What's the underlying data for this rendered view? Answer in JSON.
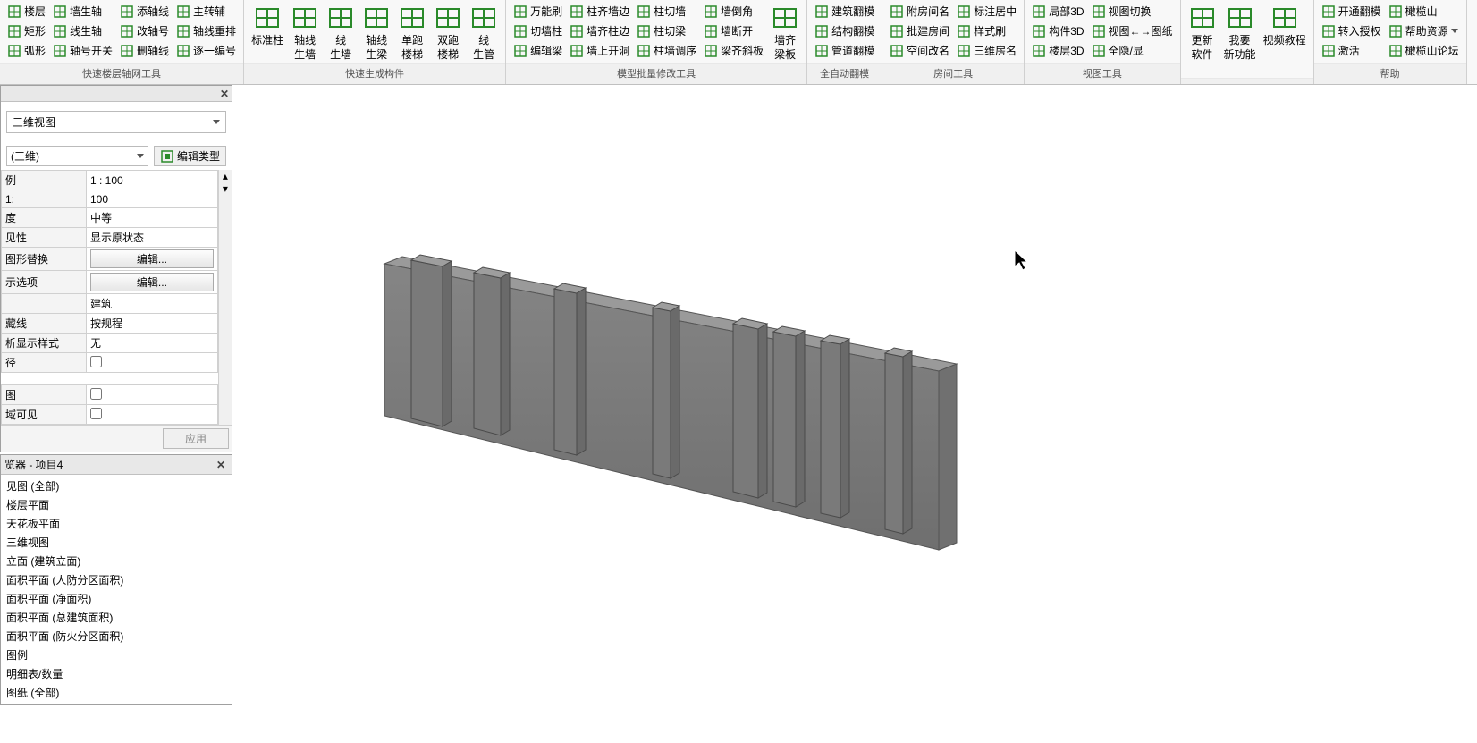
{
  "ribbon": {
    "groups": [
      {
        "title": "快速楼层轴网工具",
        "columns": [
          {
            "items": [
              {
                "icon": "floor-icon",
                "label": "楼层"
              },
              {
                "icon": "rect-icon",
                "label": "矩形"
              },
              {
                "icon": "arc-icon",
                "label": "弧形"
              }
            ]
          },
          {
            "items": [
              {
                "icon": "wall-axis-icon",
                "label": "墙生轴"
              },
              {
                "icon": "line-axis-icon",
                "label": "线生轴"
              },
              {
                "icon": "axis-switch-icon",
                "label": "轴号开关"
              }
            ]
          },
          {
            "items": [
              {
                "icon": "add-axis-icon",
                "label": "添轴线"
              },
              {
                "icon": "renumber-icon",
                "label": "改轴号"
              },
              {
                "icon": "del-axis-icon",
                "label": "删轴线"
              }
            ]
          },
          {
            "items": [
              {
                "icon": "main-aux-icon",
                "label": "主转辅"
              },
              {
                "icon": "reorder-axis-icon",
                "label": "轴线重排"
              },
              {
                "icon": "seq-number-icon",
                "label": "逐一编号"
              }
            ]
          }
        ]
      },
      {
        "title": "快速生成构件",
        "large": [
          {
            "icon": "std-col-icon",
            "label": "标准柱"
          },
          {
            "icon": "axis-wall-icon",
            "label": "轴线\n生墙"
          },
          {
            "icon": "line-wall-icon",
            "label": "线\n生墙"
          },
          {
            "icon": "axis-beam-icon",
            "label": "轴线\n生梁"
          },
          {
            "icon": "single-stair-icon",
            "label": "单跑\n楼梯"
          },
          {
            "icon": "double-stair-icon",
            "label": "双跑\n楼梯"
          },
          {
            "icon": "line-pipe-icon",
            "label": "线\n生管"
          }
        ]
      },
      {
        "title": "模型批量修改工具",
        "columns": [
          {
            "items": [
              {
                "icon": "brush-icon",
                "label": "万能刷"
              },
              {
                "icon": "cut-col-icon",
                "label": "切墙柱"
              },
              {
                "icon": "edit-beam-icon",
                "label": "编辑梁"
              }
            ]
          },
          {
            "items": [
              {
                "icon": "col-edge-icon",
                "label": "柱齐墙边"
              },
              {
                "icon": "wall-edge-icon",
                "label": "墙齐柱边"
              },
              {
                "icon": "wall-open-icon",
                "label": "墙上开洞"
              }
            ]
          },
          {
            "items": [
              {
                "icon": "col-cut-icon",
                "label": "柱切墙"
              },
              {
                "icon": "col-beam-icon",
                "label": "柱切梁"
              },
              {
                "icon": "col-adj-icon",
                "label": "柱墙调序"
              }
            ]
          },
          {
            "items": [
              {
                "icon": "wall-chamfer-icon",
                "label": "墙倒角"
              },
              {
                "icon": "wall-break-icon",
                "label": "墙断开"
              },
              {
                "icon": "beam-slant-icon",
                "label": "梁齐斜板"
              }
            ]
          }
        ],
        "large": [
          {
            "icon": "wall-align-icon",
            "label": "墙齐\n梁板"
          }
        ]
      },
      {
        "title": "全自动翻模",
        "columns": [
          {
            "items": [
              {
                "icon": "arch-flip-icon",
                "label": "建筑翻模"
              },
              {
                "icon": "struct-flip-icon",
                "label": "结构翻模"
              },
              {
                "icon": "pipe-flip-icon",
                "label": "管道翻模"
              }
            ]
          }
        ]
      },
      {
        "title": "房间工具",
        "columns": [
          {
            "items": [
              {
                "icon": "attach-room-icon",
                "label": "附房间名"
              },
              {
                "icon": "batch-room-icon",
                "label": "批建房间"
              },
              {
                "icon": "rename-space-icon",
                "label": "空间改名"
              }
            ]
          },
          {
            "items": [
              {
                "icon": "center-label-icon",
                "label": "标注居中"
              },
              {
                "icon": "style-brush-icon",
                "label": "样式刷"
              },
              {
                "icon": "room-3d-icon",
                "label": "三维房名"
              }
            ]
          }
        ]
      },
      {
        "title": "视图工具",
        "columns": [
          {
            "items": [
              {
                "icon": "local3d-icon",
                "label": "局部3D"
              },
              {
                "icon": "comp3d-icon",
                "label": "构件3D"
              },
              {
                "icon": "floor3d-icon",
                "label": "楼层3D"
              }
            ]
          },
          {
            "items": [
              {
                "icon": "view-switch-icon",
                "label": "视图切换"
              },
              {
                "icon": "view-to-sheet-icon",
                "label": "视图←→图纸"
              },
              {
                "icon": "full-hide-icon",
                "label": "全隐/显"
              }
            ]
          }
        ]
      },
      {
        "title": "",
        "large": [
          {
            "icon": "update-sw-icon",
            "label": "更新\n软件"
          },
          {
            "icon": "new-feat-icon",
            "label": "我要\n新功能"
          },
          {
            "icon": "video-icon",
            "label": "视频教程"
          }
        ]
      },
      {
        "title": "帮助",
        "columns": [
          {
            "items": [
              {
                "icon": "unlock-icon",
                "label": "开通翻模"
              },
              {
                "icon": "auth-icon",
                "label": "转入授权"
              },
              {
                "icon": "activate-icon",
                "label": "激活"
              }
            ]
          },
          {
            "items": [
              {
                "icon": "olive-icon",
                "label": "橄榄山"
              },
              {
                "icon": "help-res-icon",
                "label": "帮助资源",
                "dropdown": true
              },
              {
                "icon": "forum-icon",
                "label": "橄榄山论坛"
              }
            ]
          }
        ]
      }
    ]
  },
  "properties": {
    "comboLabel": "三维视图",
    "typeSelector": "(三维)",
    "editTypeBtn": "编辑类型",
    "rows": [
      {
        "label": "例",
        "type": "text",
        "value": "1 : 100"
      },
      {
        "label": "1:",
        "type": "readonly",
        "value": "100"
      },
      {
        "label": "度",
        "type": "readonly",
        "value": "中等"
      },
      {
        "label": "见性",
        "type": "readonly",
        "value": "显示原状态"
      },
      {
        "label": "图形替换",
        "type": "button",
        "value": "编辑..."
      },
      {
        "label": "示选项",
        "type": "button",
        "value": "编辑..."
      },
      {
        "label": "",
        "type": "readonly",
        "value": "建筑"
      },
      {
        "label": "藏线",
        "type": "readonly",
        "value": "按规程"
      },
      {
        "label": "析显示样式",
        "type": "readonly",
        "value": "无"
      },
      {
        "label": "径",
        "type": "check",
        "value": false
      },
      {
        "label": "图",
        "type": "check",
        "value": false
      },
      {
        "label": "域可见",
        "type": "check",
        "value": false
      }
    ],
    "applyBtn": "应用"
  },
  "browser": {
    "title": "览器 - 项目4",
    "items": [
      "见图 (全部)",
      "楼层平面",
      "天花板平面",
      "三维视图",
      "立面 (建筑立面)",
      "面积平面 (人防分区面积)",
      "面积平面 (净面积)",
      "面积平面 (总建筑面积)",
      "面积平面 (防火分区面积)",
      "图例",
      "明细表/数量",
      "图纸 (全部)"
    ]
  }
}
